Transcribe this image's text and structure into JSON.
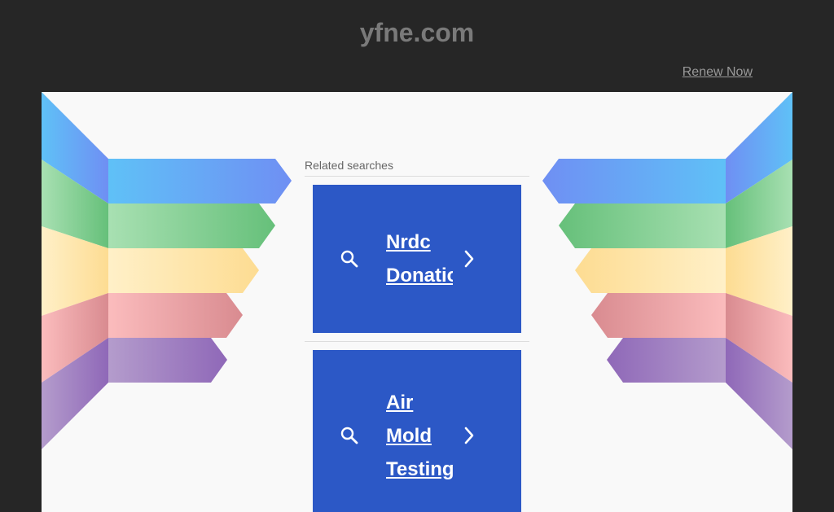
{
  "header": {
    "domain": "yfne.com",
    "renew_label": "Renew Now"
  },
  "related": {
    "title": "Related searches",
    "items": [
      {
        "lines": [
          "Nrdc",
          "Donations"
        ]
      },
      {
        "lines": [
          "Air",
          "Mold",
          "Testing"
        ]
      }
    ]
  },
  "icons": {
    "search": "search-icon",
    "chevron": "chevron-right-icon"
  },
  "colors": {
    "background": "#262626",
    "panel": "#f9f9f9",
    "card": "#2c58c6",
    "blue": "#6aa3f7",
    "green": "#7fcf8f",
    "yellow": "#fde5a8",
    "red": "#f0a4a8",
    "purple": "#a488c6"
  }
}
